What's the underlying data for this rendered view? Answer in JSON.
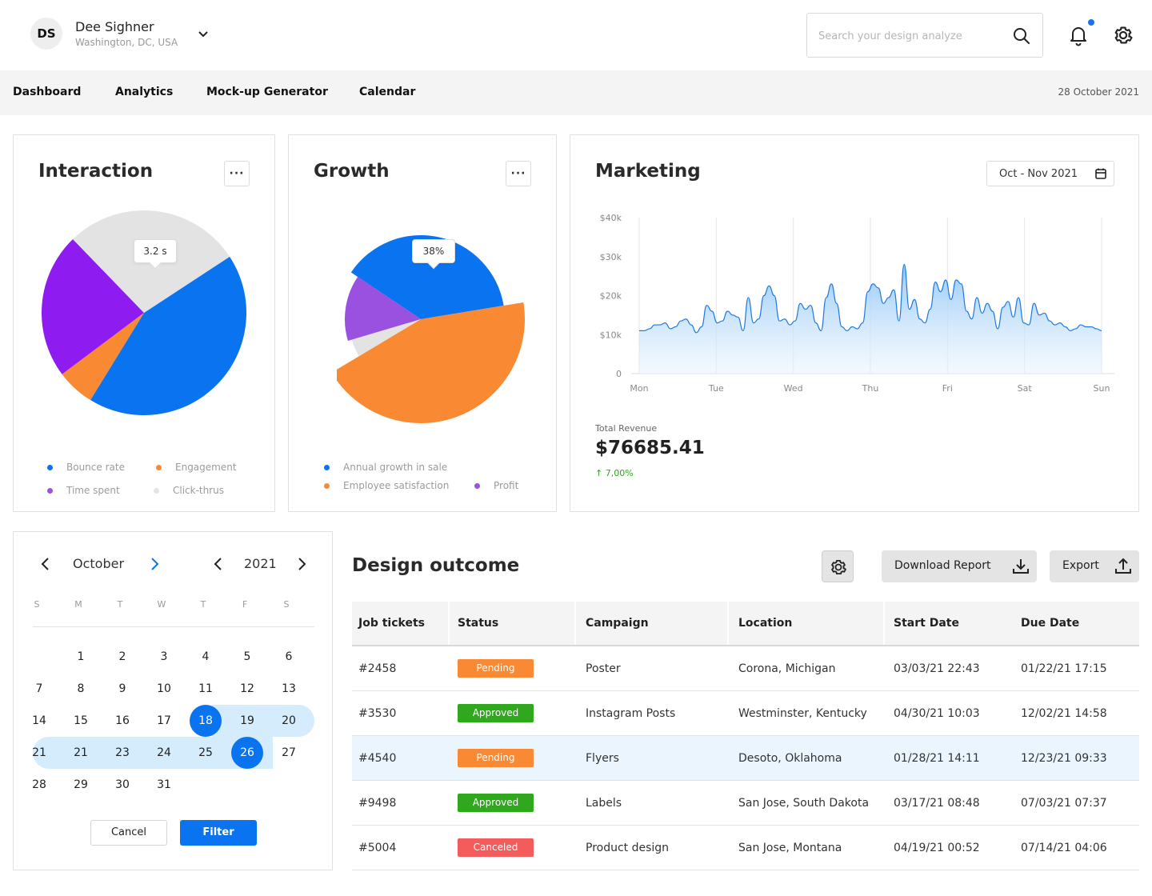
{
  "user": {
    "initials": "DS",
    "name": "Dee Sighner",
    "location": "Washington, DC, USA"
  },
  "search": {
    "placeholder": "Search your design analyze"
  },
  "nav": {
    "items": [
      "Dashboard",
      "Analytics",
      "Mock-up Generator",
      "Calendar"
    ],
    "date": "28 October 2021"
  },
  "interaction": {
    "title": "Interaction",
    "more": "···",
    "tooltip": "3.2 s",
    "legend": [
      "Bounce rate",
      "Engagement",
      "Time spent",
      "Click-thrus"
    ]
  },
  "growth": {
    "title": "Growth",
    "more": "···",
    "tooltip": "38%",
    "legend": [
      "Annual growth in sale",
      "Employee satisfaction",
      "Profit"
    ]
  },
  "marketing": {
    "title": "Marketing",
    "date_range": "Oct - Nov 2021",
    "revenue_label": "Total Revenue",
    "revenue_value": "$76685.41",
    "revenue_change": "↑ 7,00%"
  },
  "colors": {
    "blue": "#0a74f0",
    "orange": "#f98a33",
    "purple": "#8e1cf0",
    "purple_light": "#9b51e0",
    "gray": "#e3e3e3",
    "green": "#2fa81d",
    "red": "#f45b5b"
  },
  "chart_data": [
    {
      "type": "pie",
      "labels": [
        "Bounce rate",
        "Engagement",
        "Time spent",
        "Click-thrus"
      ],
      "values": [
        43,
        6,
        23,
        28
      ]
    },
    {
      "type": "pie",
      "labels": [
        "Annual growth in sale",
        "Employee satisfaction",
        "Profit"
      ],
      "values": [
        38,
        44,
        14,
        4
      ],
      "extra_slice_note": ""
    },
    {
      "type": "area",
      "x": [
        "Mon",
        "Tue",
        "Wed",
        "Thu",
        "Fri",
        "Sat",
        "Sun"
      ],
      "y_ticks": [
        "$40k",
        "$30k",
        "$20k",
        "$10k",
        "0"
      ],
      "ylim": [
        0,
        40000
      ],
      "values": [
        11000,
        11000,
        11500,
        12500,
        12500,
        13000,
        11500,
        12000,
        13500,
        14000,
        12500,
        10500,
        12000,
        17500,
        16000,
        13000,
        13500,
        16000,
        15000,
        14500,
        11000,
        19500,
        13000,
        14000,
        20000,
        22500,
        20000,
        13500,
        14000,
        12500,
        13500,
        18000,
        16500,
        17500,
        13000,
        11000,
        19500,
        23000,
        18000,
        12000,
        11000,
        12000,
        11500,
        13000,
        21000,
        23000,
        22000,
        18000,
        19500,
        21500,
        13500,
        28000,
        16500,
        19000,
        14000,
        13000,
        16500,
        23500,
        21000,
        24000,
        19000,
        24000,
        23000,
        16000,
        14000,
        19500,
        15500,
        18000,
        16000,
        11500,
        17000,
        18500,
        14500,
        19500,
        13000,
        12500,
        18000,
        15000,
        15500,
        13500,
        12500,
        13000,
        12000,
        11000,
        11500,
        12500,
        12000,
        12000,
        11500,
        11000
      ]
    }
  ],
  "calendar": {
    "month": "October",
    "year": "2021",
    "weekdays": [
      "S",
      "M",
      "T",
      "W",
      "T",
      "F",
      "S"
    ],
    "weeks": [
      [
        "",
        "1",
        "2",
        "3",
        "4",
        "5",
        "6"
      ],
      [
        "7",
        "8",
        "9",
        "10",
        "11",
        "12",
        "13"
      ],
      [
        "14",
        "15",
        "16",
        "17",
        "18",
        "19",
        "20"
      ],
      [
        "21",
        "21",
        "23",
        "24",
        "25",
        "26",
        "27"
      ],
      [
        "28",
        "29",
        "30",
        "31",
        "",
        "",
        ""
      ]
    ],
    "selected": [
      "18",
      "26"
    ],
    "cancel": "Cancel",
    "filter": "Filter"
  },
  "outcome": {
    "title": "Design outcome",
    "download": "Download Report",
    "export": "Export",
    "headers": [
      "Job tickets",
      "Status",
      "Campaign",
      "Location",
      "Start Date",
      "Due Date"
    ],
    "rows": [
      {
        "ticket": "#2458",
        "status": "Pending",
        "campaign": "Poster",
        "location": "Corona, Michigan",
        "start": "03/03/21 22:43",
        "due": "01/22/21 17:15"
      },
      {
        "ticket": "#3530",
        "status": "Approved",
        "campaign": "Instagram Posts",
        "location": "Westminster, Kentucky",
        "start": "04/30/21 10:03",
        "due": "12/02/21 14:58"
      },
      {
        "ticket": "#4540",
        "status": "Pending",
        "campaign": "Flyers",
        "location": "Desoto, Oklahoma",
        "start": "01/28/21 14:11",
        "due": "12/23/21 09:33"
      },
      {
        "ticket": "#9498",
        "status": "Approved",
        "campaign": "Labels",
        "location": "San Jose, South Dakota",
        "start": "03/17/21 08:48",
        "due": "07/03/21 07:37"
      },
      {
        "ticket": "#5004",
        "status": "Canceled",
        "campaign": "Product design",
        "location": "San Jose, Montana",
        "start": "04/19/21 00:52",
        "due": "07/14/21 04:06"
      }
    ]
  }
}
